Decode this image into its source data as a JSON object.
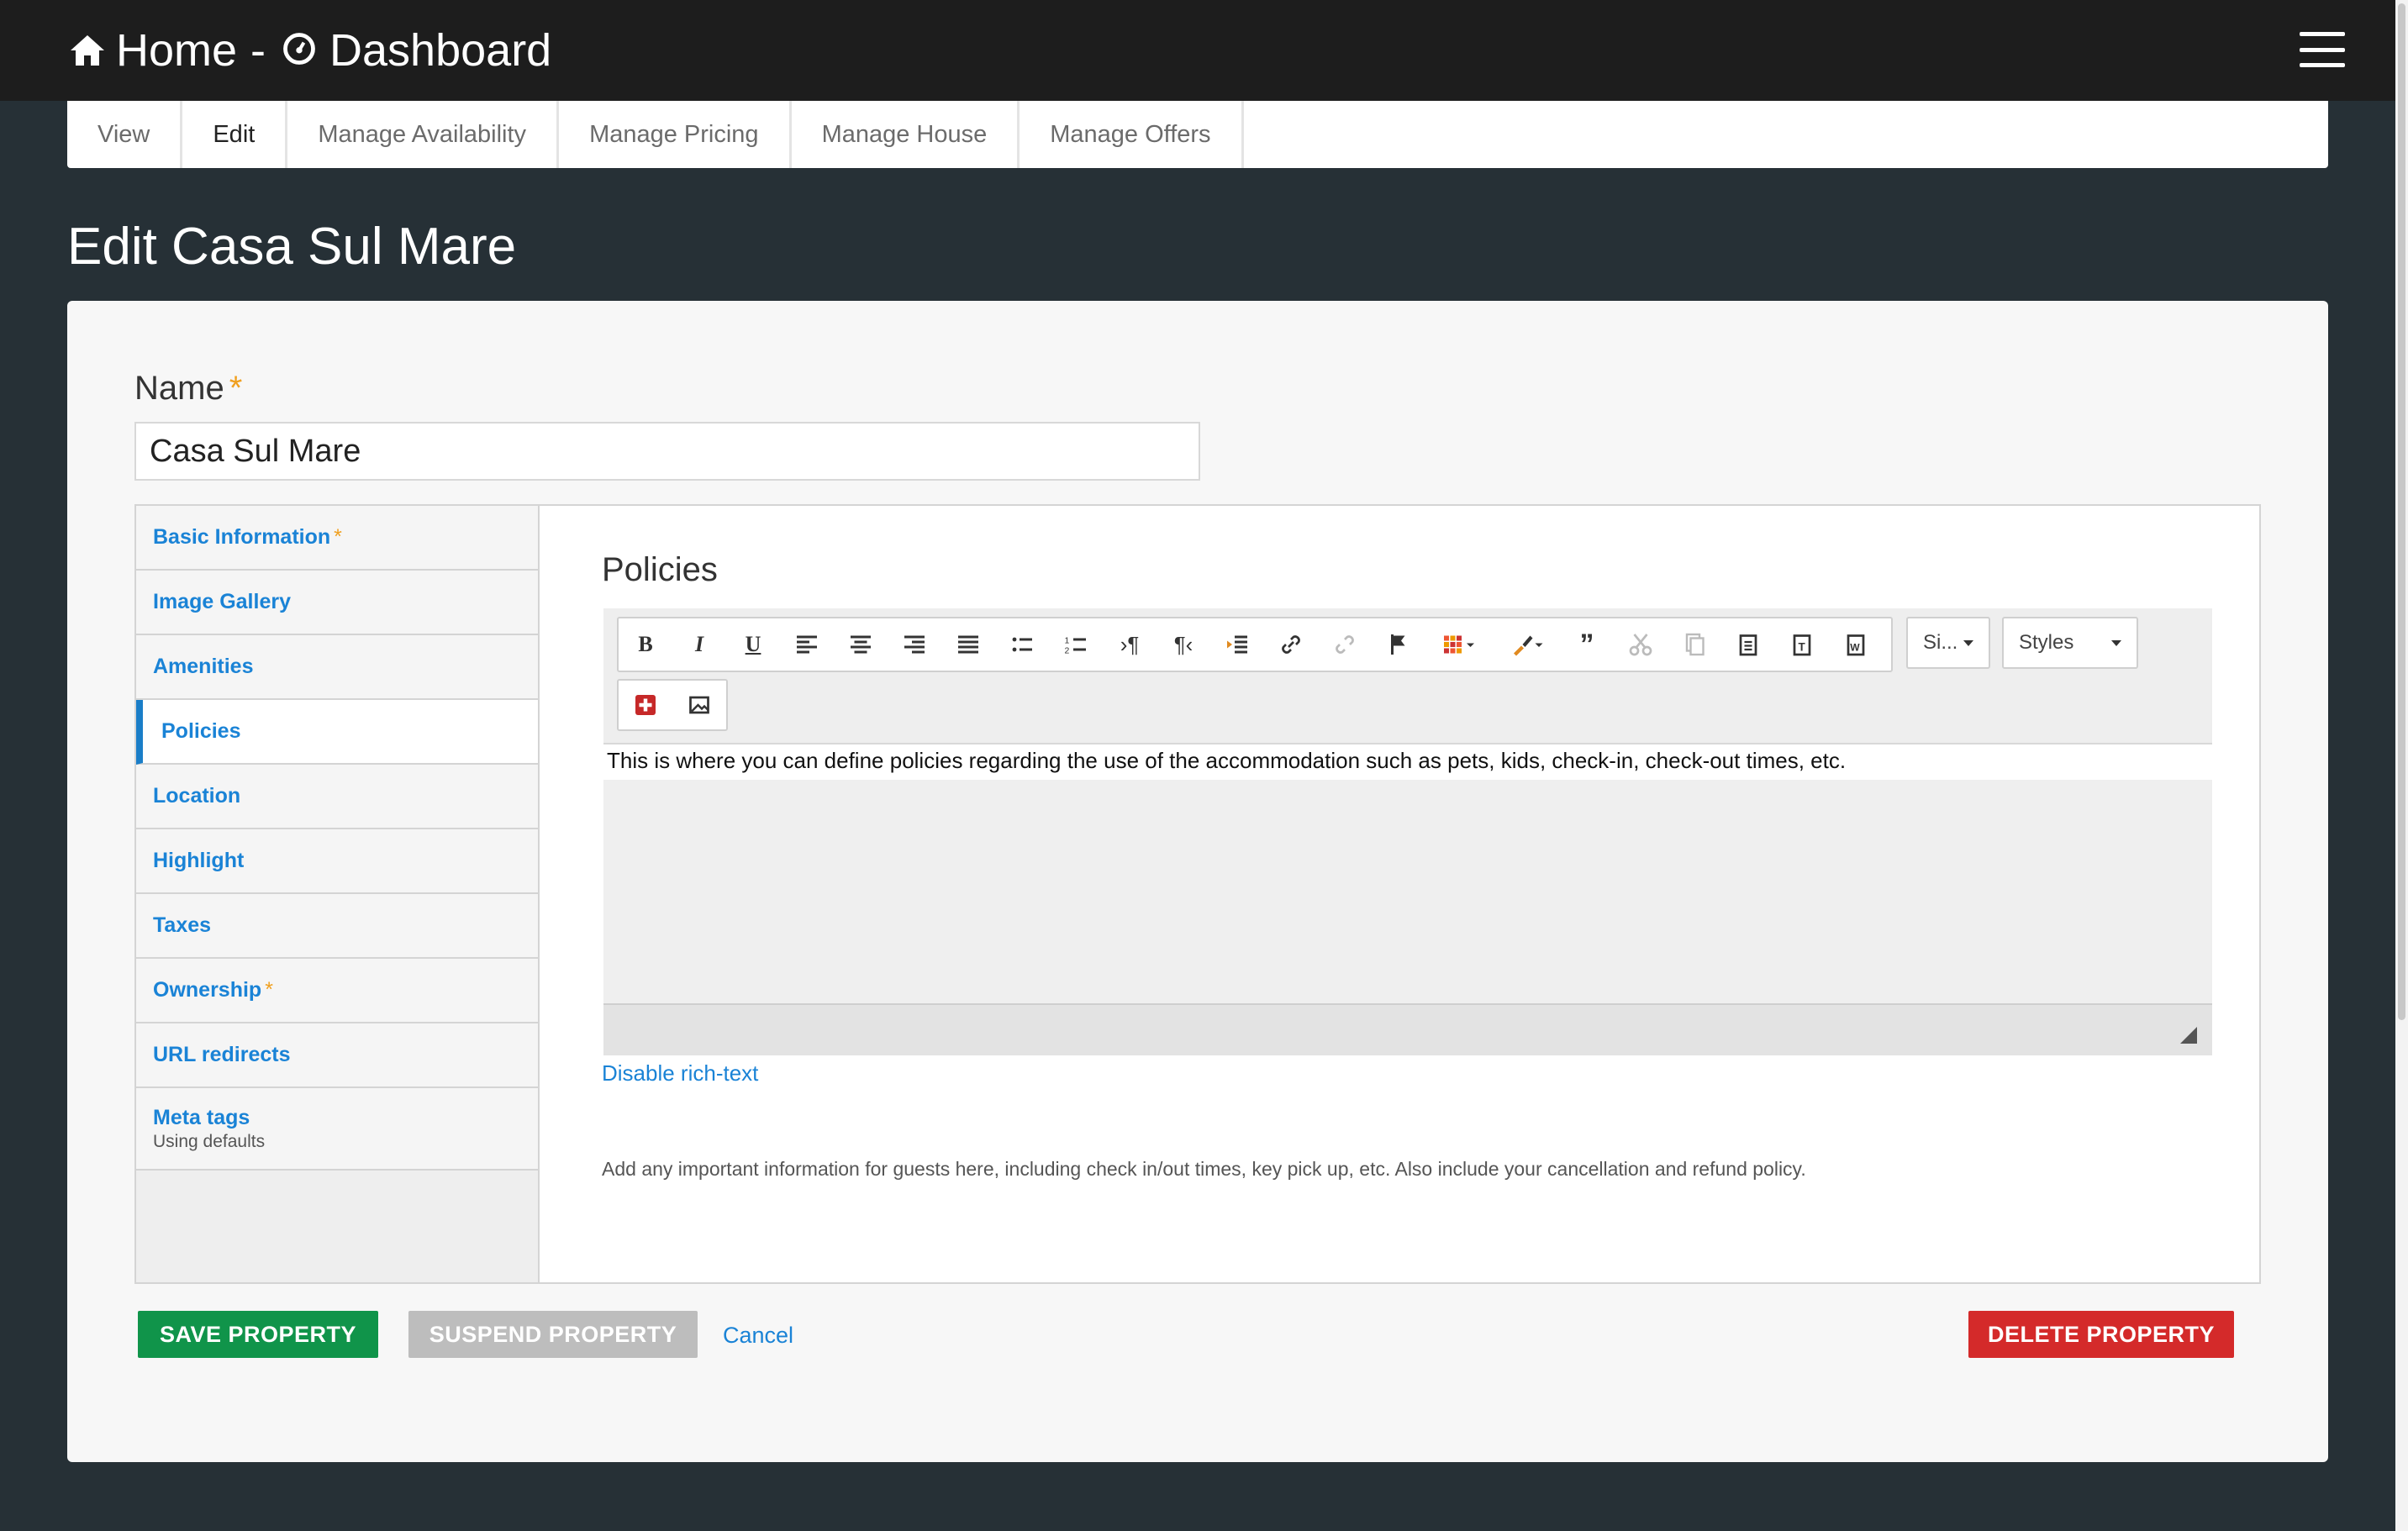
{
  "header": {
    "home_label": "Home",
    "separator": "-",
    "dashboard_label": "Dashboard"
  },
  "tabs": [
    {
      "label": "View"
    },
    {
      "label": "Edit"
    },
    {
      "label": "Manage Availability"
    },
    {
      "label": "Manage Pricing"
    },
    {
      "label": "Manage House"
    },
    {
      "label": "Manage Offers"
    }
  ],
  "page_title": "Edit Casa Sul Mare",
  "form": {
    "name_label": "Name",
    "required_mark": "*",
    "name_value": "Casa Sul Mare"
  },
  "vertical_tabs": [
    {
      "label": "Basic Information",
      "required": "*"
    },
    {
      "label": "Image Gallery"
    },
    {
      "label": "Amenities"
    },
    {
      "label": "Policies"
    },
    {
      "label": "Location"
    },
    {
      "label": "Highlight"
    },
    {
      "label": "Taxes"
    },
    {
      "label": "Ownership",
      "required": "*"
    },
    {
      "label": "URL redirects"
    },
    {
      "label": "Meta tags",
      "sub": "Using defaults"
    }
  ],
  "pane": {
    "title": "Policies",
    "size_dropdown": "Si...",
    "styles_dropdown": "Styles",
    "editor_text": "This is where you can define policies regarding the use of the accommodation such as pets, kids, check-in, check-out times, etc.",
    "disable_link": "Disable rich-text",
    "help_text": "Add any important information for guests here, including check in/out times, key pick up, etc. Also include your cancellation and refund policy."
  },
  "actions": {
    "save": "SAVE PROPERTY",
    "suspend": "SUSPEND PROPERTY",
    "cancel": "Cancel",
    "delete": "DELETE PROPERTY"
  },
  "colors": {
    "save": "#10944a",
    "delete": "#d42a2a",
    "link": "#1a83d6",
    "required": "#f0a020"
  }
}
